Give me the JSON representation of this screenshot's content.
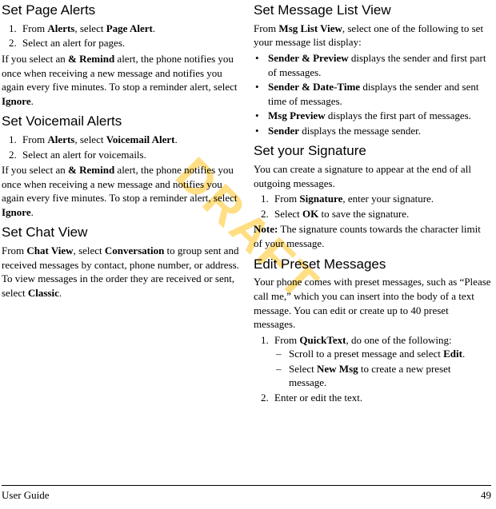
{
  "watermark": "DRAFT",
  "left": {
    "pageAlerts": {
      "heading": "Set Page Alerts",
      "step1_pre": "From ",
      "step1_b1": "Alerts",
      "step1_mid": ", select ",
      "step1_b2": "Page Alert",
      "step1_post": ".",
      "step2": "Select an alert for pages.",
      "para_pre": "If you select an ",
      "para_b1": "& Remind",
      "para_mid": " alert, the phone notifies you once when receiving a new message and notifies you again every five minutes. To stop a reminder alert, select ",
      "para_b2": "Ignore",
      "para_post": "."
    },
    "voicemailAlerts": {
      "heading": "Set Voicemail Alerts",
      "step1_pre": "From ",
      "step1_b1": "Alerts",
      "step1_mid": ", select ",
      "step1_b2": "Voicemail Alert",
      "step1_post": ".",
      "step2": "Select an alert for voicemails.",
      "para_pre": "If you select an ",
      "para_b1": "& Remind",
      "para_mid": " alert, the phone notifies you once when receiving a new message and notifies you again every five minutes. To stop a reminder alert, select ",
      "para_b2": "Ignore",
      "para_post": "."
    },
    "chatView": {
      "heading": "Set Chat View",
      "para_pre": "From ",
      "para_b1": "Chat View",
      "para_mid1": ", select ",
      "para_b2": "Conversation",
      "para_mid2": " to group sent and received messages by contact, phone number, or address. To view messages in the order they are received or sent, select ",
      "para_b3": "Classic",
      "para_post": "."
    }
  },
  "right": {
    "msgListView": {
      "heading": "Set Message List View",
      "intro_pre": "From ",
      "intro_b": "Msg List View",
      "intro_post": ", select one of the following to set your message list display:",
      "b1_b": "Sender & Preview",
      "b1_post": " displays the sender and first part of messages.",
      "b2_b": "Sender & Date-Time",
      "b2_post": " displays the sender and sent time of messages.",
      "b3_b": "Msg Preview",
      "b3_post": " displays the first part of messages.",
      "b4_b": "Sender",
      "b4_post": " displays the message sender."
    },
    "signature": {
      "heading": "Set your Signature",
      "intro": "You can create a signature to appear at the end of all outgoing messages.",
      "s1_pre": "From ",
      "s1_b": "Signature",
      "s1_post": ", enter your signature.",
      "s2_pre": "Select ",
      "s2_b": "OK",
      "s2_post": " to save the signature.",
      "note_b": "Note:",
      "note_post": " The signature counts towards the character limit of your message."
    },
    "preset": {
      "heading": "Edit Preset Messages",
      "intro": "Your phone comes with preset messages, such as “Please call me,” which you can insert into the body of a text message. You can edit or create up to 40 preset messages.",
      "s1_pre": "From ",
      "s1_b": "QuickText",
      "s1_post": ", do one of the following:",
      "d1_pre": "Scroll to a preset message and select ",
      "d1_b": "Edit",
      "d1_post": ".",
      "d2_pre": "Select ",
      "d2_b": "New Msg",
      "d2_post": " to create a new preset message.",
      "s2": "Enter or edit the text."
    }
  },
  "footer": {
    "left": "User Guide",
    "right": "49"
  }
}
